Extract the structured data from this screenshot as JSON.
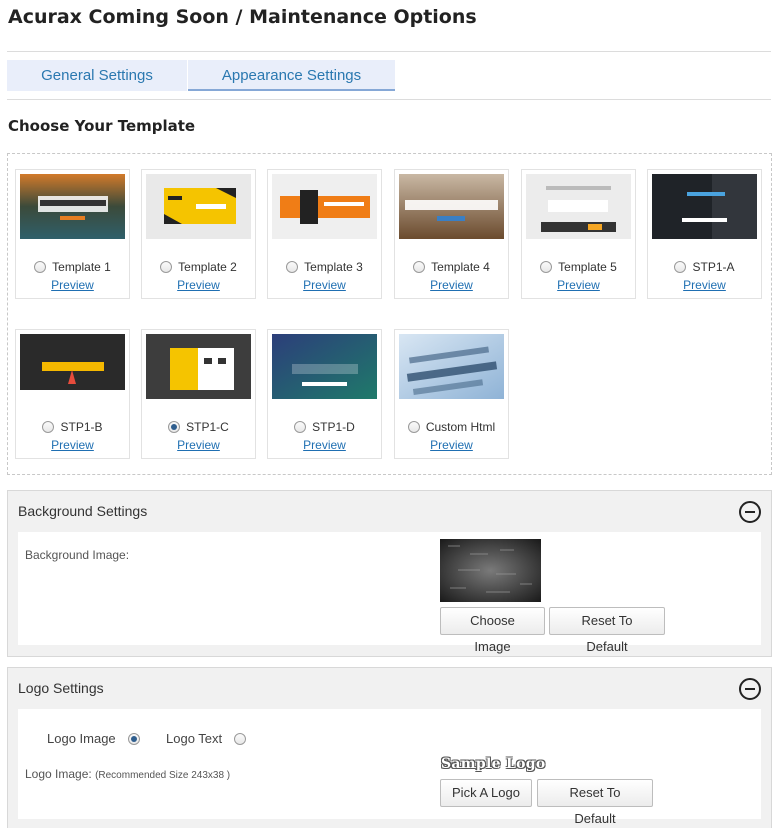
{
  "page": {
    "title": "Acurax Coming Soon / Maintenance Options"
  },
  "tabs": [
    {
      "label": "General Settings",
      "active": false
    },
    {
      "label": "Appearance Settings",
      "active": true
    }
  ],
  "templates_section": {
    "heading": "Choose Your Template",
    "preview_label": "Preview",
    "templates": [
      {
        "name": "Template 1",
        "selected": false
      },
      {
        "name": "Template 2",
        "selected": false
      },
      {
        "name": "Template 3",
        "selected": false
      },
      {
        "name": "Template 4",
        "selected": false
      },
      {
        "name": "Template 5",
        "selected": false
      },
      {
        "name": "STP1-A",
        "selected": false
      },
      {
        "name": "STP1-B",
        "selected": false
      },
      {
        "name": "STP1-C",
        "selected": true
      },
      {
        "name": "STP1-D",
        "selected": false
      },
      {
        "name": "Custom Html",
        "selected": false
      }
    ]
  },
  "background_settings": {
    "header": "Background Settings",
    "image_label": "Background Image:",
    "choose_button": "Choose Image",
    "reset_button": "Reset To Default"
  },
  "logo_settings": {
    "header": "Logo Settings",
    "option_image": "Logo Image",
    "option_text": "Logo Text",
    "selected_option": "Logo Image",
    "image_label": "Logo Image:",
    "image_hint": "(Recommended Size 243x38 )",
    "sample_logo": "Sample Logo",
    "pick_button": "Pick A Logo",
    "reset_button": "Reset To Default"
  },
  "colors": {
    "tab_bg": "#e9eefa",
    "tab_text": "#2a78b0",
    "link": "#1f6fb2",
    "panel_bg": "#f1f1f1"
  }
}
